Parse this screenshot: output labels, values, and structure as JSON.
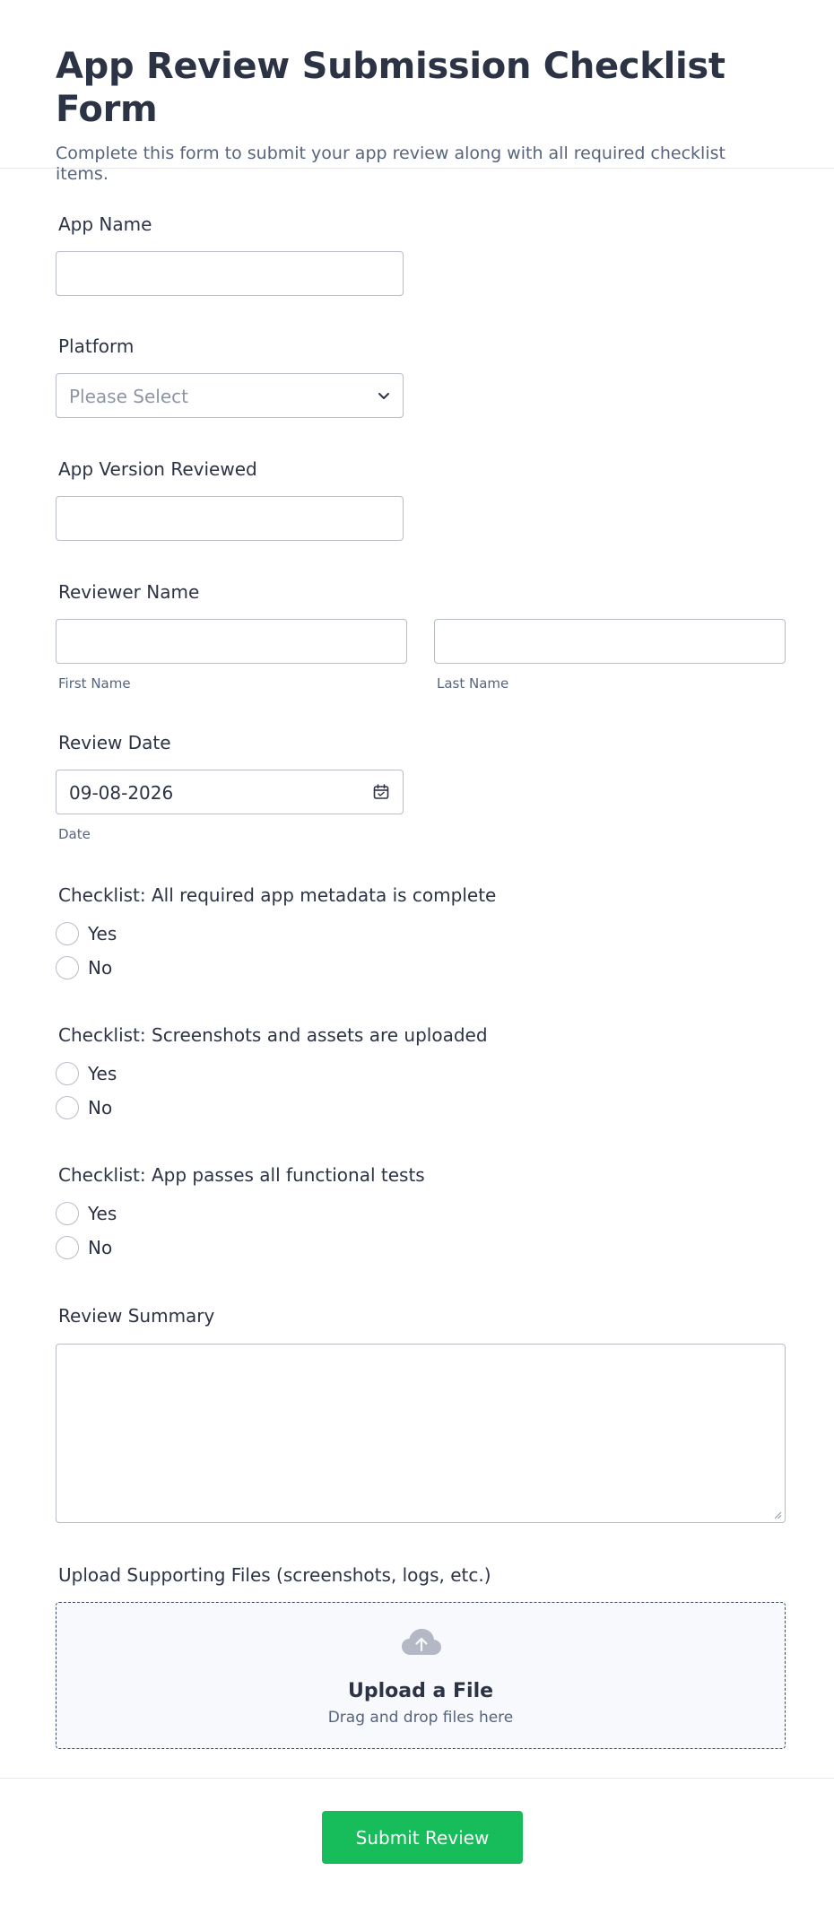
{
  "header": {
    "title": "App Review Submission Checklist Form",
    "subtitle": "Complete this form to submit your app review along with all required checklist items."
  },
  "fields": {
    "app_name": {
      "label": "App Name",
      "value": ""
    },
    "platform": {
      "label": "Platform",
      "placeholder": "Please Select"
    },
    "app_version": {
      "label": "App Version Reviewed",
      "value": ""
    },
    "reviewer_name": {
      "label": "Reviewer Name",
      "first_sublabel": "First Name",
      "last_sublabel": "Last Name"
    },
    "review_date": {
      "label": "Review Date",
      "value": "09-08-2026",
      "sublabel": "Date"
    },
    "checklist_metadata": {
      "label": "Checklist: All required app metadata is complete",
      "options": [
        "Yes",
        "No"
      ]
    },
    "checklist_screenshots": {
      "label": "Checklist: Screenshots and assets are uploaded",
      "options": [
        "Yes",
        "No"
      ]
    },
    "checklist_tests": {
      "label": "Checklist: App passes all functional tests",
      "options": [
        "Yes",
        "No"
      ]
    },
    "review_summary": {
      "label": "Review Summary",
      "value": ""
    },
    "upload": {
      "label": "Upload Supporting Files (screenshots, logs, etc.)",
      "title": "Upload a File",
      "subtitle": "Drag and drop files here"
    }
  },
  "submit": {
    "label": "Submit Review",
    "color": "#18bd5b"
  },
  "icons": {
    "select": "chevron-down-icon",
    "date": "calendar-icon",
    "upload": "cloud-upload-icon"
  }
}
